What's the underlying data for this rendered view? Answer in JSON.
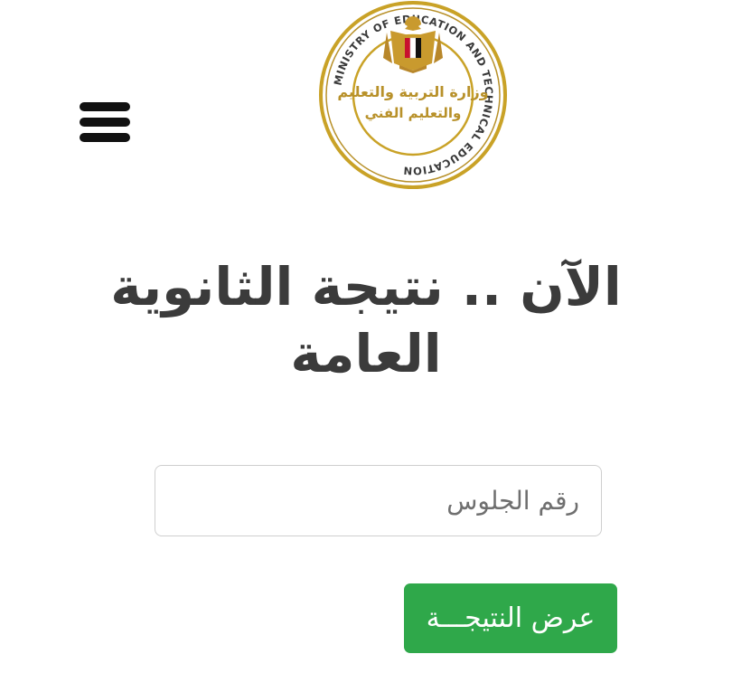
{
  "header": {
    "menu_icon": "hamburger-menu-icon",
    "logo": {
      "icon": "ministry-seal-icon",
      "ring_text": "MINISTRY OF EDUCATION AND TECHNICAL EDUCATION",
      "arabic_line1": "وزارة التربية والتعليم",
      "arabic_line2": "والتعليم الفني",
      "colors": {
        "gold": "#c9a227",
        "ring": "#b8912a",
        "eagle": "#c99a2e",
        "flag_red": "#c8102e",
        "flag_black": "#111111"
      }
    }
  },
  "main": {
    "headline": "الآن .. نتيجة الثانوية العامة",
    "seat_number": {
      "placeholder": "رقم الجلوس",
      "value": ""
    },
    "submit_label": "عرض النتيجـــة"
  },
  "colors": {
    "button_bg": "#2fa84a",
    "headline": "#3b3b3b",
    "input_border": "#cfcfcf"
  }
}
